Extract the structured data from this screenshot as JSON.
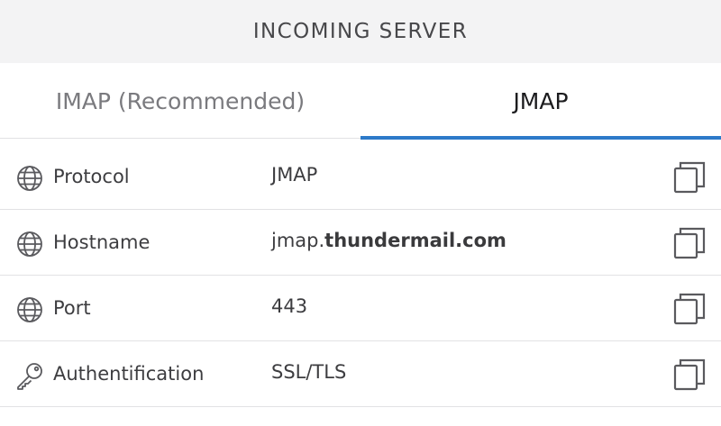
{
  "header": {
    "title": "INCOMING SERVER"
  },
  "tabs": [
    {
      "label": "IMAP (Recommended)",
      "active": false
    },
    {
      "label": "JMAP",
      "active": true
    }
  ],
  "rows": [
    {
      "icon": "globe-icon",
      "label": "Protocol",
      "value": "JMAP"
    },
    {
      "icon": "globe-icon",
      "label": "Hostname",
      "value_prefix": "jmap.",
      "value_bold": "thundermail.com"
    },
    {
      "icon": "globe-icon",
      "label": "Port",
      "value": "443"
    },
    {
      "icon": "key-icon",
      "label": "Authentification",
      "value": "SSL/TLS"
    }
  ],
  "colors": {
    "accent": "#2d7ac9",
    "header_bg": "#f3f3f4",
    "divider": "#e2e2e4"
  }
}
